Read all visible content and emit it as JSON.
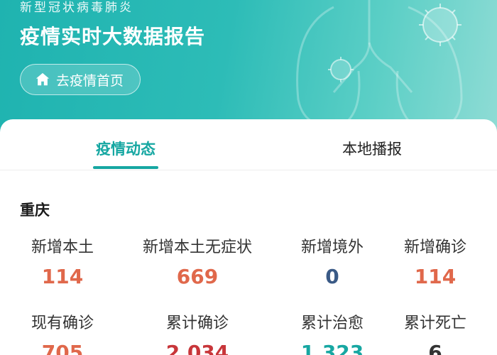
{
  "header": {
    "subtitle": "新型冠状病毒肺炎",
    "title": "疫情实时大数据报告",
    "home_button_label": "去疫情首页"
  },
  "tabs": [
    {
      "label": "疫情动态",
      "active": true
    },
    {
      "label": "本地播报",
      "active": false
    }
  ],
  "region": "重庆",
  "stats": [
    {
      "label": "新增本土",
      "value": "114",
      "color": "#e0684b"
    },
    {
      "label": "新增本土无症状",
      "value": "669",
      "color": "#e0684b"
    },
    {
      "label": "新增境外",
      "value": "0",
      "color": "#3a5a86"
    },
    {
      "label": "新增确诊",
      "value": "114",
      "color": "#e0684b"
    },
    {
      "label": "现有确诊",
      "value": "705",
      "color": "#e0684b"
    },
    {
      "label": "累计确诊",
      "value": "2,034",
      "color": "#c8363a"
    },
    {
      "label": "累计治愈",
      "value": "1,323",
      "color": "#17a7a2"
    },
    {
      "label": "累计死亡",
      "value": "6",
      "color": "#333333"
    }
  ],
  "colors": {
    "accent": "#16a7a2",
    "hero_start": "#1fb3b0",
    "hero_end": "#8fdcd5"
  },
  "icons": {
    "home": "home-icon",
    "virus": "virus-icon"
  }
}
